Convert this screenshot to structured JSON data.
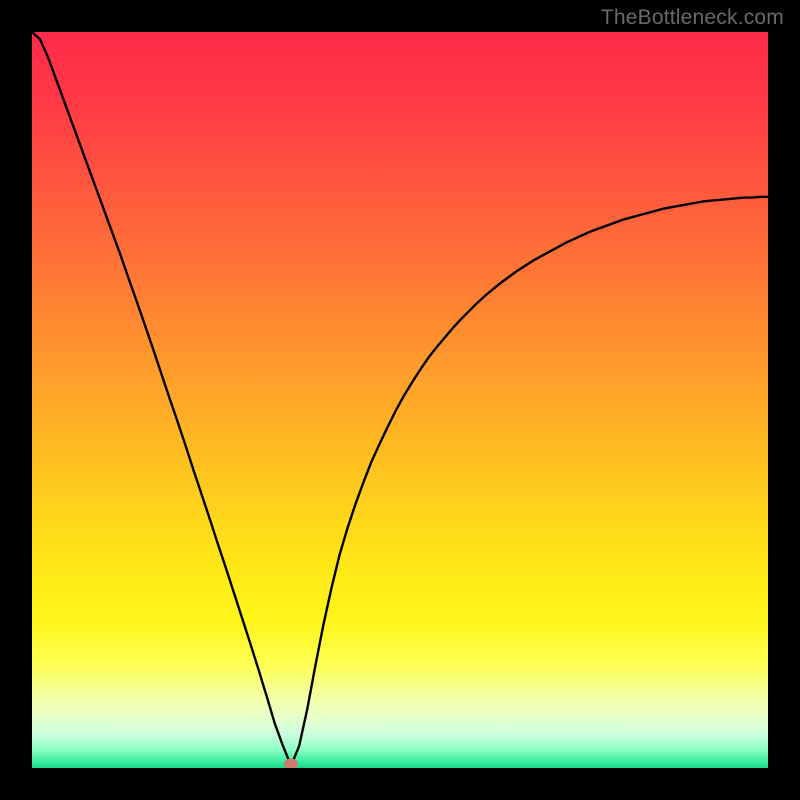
{
  "watermark": "TheBottleneck.com",
  "marker": {
    "x_frac": 0.352,
    "y_frac": 0.994
  },
  "gradient_stops": [
    {
      "offset": 0.0,
      "color": "#ff2a4a"
    },
    {
      "offset": 0.1,
      "color": "#ff3a45"
    },
    {
      "offset": 0.22,
      "color": "#ff5a3e"
    },
    {
      "offset": 0.35,
      "color": "#ff7d34"
    },
    {
      "offset": 0.48,
      "color": "#ffa22a"
    },
    {
      "offset": 0.6,
      "color": "#ffc51f"
    },
    {
      "offset": 0.72,
      "color": "#ffe617"
    },
    {
      "offset": 0.8,
      "color": "#fff61a"
    },
    {
      "offset": 0.86,
      "color": "#fdff54"
    },
    {
      "offset": 0.9,
      "color": "#f5ffa0"
    },
    {
      "offset": 0.93,
      "color": "#e8ffc8"
    },
    {
      "offset": 0.955,
      "color": "#c9ffdf"
    },
    {
      "offset": 0.975,
      "color": "#8effc4"
    },
    {
      "offset": 0.995,
      "color": "#28e796"
    },
    {
      "offset": 1.0,
      "color": "#1fd38a"
    }
  ],
  "chart_data": {
    "type": "line",
    "title": "",
    "xlabel": "",
    "ylabel": "",
    "xlim": [
      0,
      1
    ],
    "ylim": [
      0,
      1
    ],
    "note": "Axis values are normalized fractions of the 736×736 plot area; no numeric tick labels are shown in the source image.",
    "x": [
      0.0,
      0.011,
      0.022,
      0.033,
      0.044,
      0.055,
      0.066,
      0.077,
      0.088,
      0.099,
      0.11,
      0.121,
      0.132,
      0.143,
      0.154,
      0.165,
      0.176,
      0.187,
      0.198,
      0.209,
      0.22,
      0.231,
      0.242,
      0.253,
      0.264,
      0.275,
      0.286,
      0.297,
      0.308,
      0.319,
      0.33,
      0.341,
      0.352,
      0.363,
      0.374,
      0.385,
      0.396,
      0.407,
      0.418,
      0.429,
      0.44,
      0.451,
      0.462,
      0.473,
      0.484,
      0.495,
      0.506,
      0.517,
      0.528,
      0.539,
      0.55,
      0.561,
      0.572,
      0.583,
      0.594,
      0.605,
      0.616,
      0.627,
      0.638,
      0.649,
      0.66,
      0.671,
      0.682,
      0.693,
      0.704,
      0.715,
      0.726,
      0.737,
      0.748,
      0.759,
      0.77,
      0.781,
      0.792,
      0.803,
      0.814,
      0.825,
      0.836,
      0.847,
      0.858,
      0.869,
      0.88,
      0.891,
      0.902,
      0.913,
      0.924,
      0.935,
      0.946,
      0.957,
      0.968,
      0.979,
      0.99,
      1.0
    ],
    "values": [
      1.0,
      0.99,
      0.965,
      0.935,
      0.905,
      0.875,
      0.845,
      0.815,
      0.785,
      0.755,
      0.725,
      0.695,
      0.663,
      0.632,
      0.6,
      0.568,
      0.535,
      0.502,
      0.47,
      0.437,
      0.403,
      0.37,
      0.337,
      0.303,
      0.27,
      0.236,
      0.202,
      0.168,
      0.133,
      0.097,
      0.06,
      0.03,
      0.003,
      0.03,
      0.08,
      0.139,
      0.195,
      0.245,
      0.29,
      0.327,
      0.36,
      0.39,
      0.418,
      0.442,
      0.465,
      0.487,
      0.507,
      0.525,
      0.542,
      0.558,
      0.572,
      0.585,
      0.598,
      0.61,
      0.621,
      0.632,
      0.642,
      0.651,
      0.66,
      0.668,
      0.676,
      0.683,
      0.69,
      0.696,
      0.702,
      0.708,
      0.714,
      0.719,
      0.724,
      0.729,
      0.733,
      0.737,
      0.741,
      0.745,
      0.748,
      0.751,
      0.754,
      0.757,
      0.76,
      0.762,
      0.764,
      0.766,
      0.768,
      0.77,
      0.771,
      0.772,
      0.773,
      0.774,
      0.775,
      0.775,
      0.776,
      0.776
    ],
    "annotations": [
      {
        "type": "marker",
        "x": 0.352,
        "y": 0.003,
        "label": "minimum"
      }
    ]
  }
}
